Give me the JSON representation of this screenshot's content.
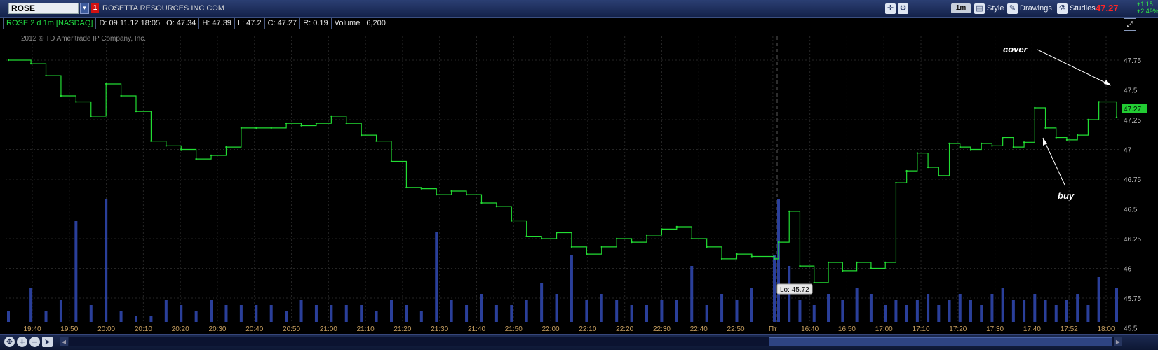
{
  "header": {
    "symbol": "ROSE",
    "link_badge": "1",
    "company": "ROSETTA RESOURCES INC COM",
    "aggregation": "1m",
    "style_label": "Style",
    "drawings_label": "Drawings",
    "studies_label": "Studies",
    "last_price": "47.27",
    "change_abs": "+1.15",
    "change_pct": "+2.49%",
    "icons": [
      "crosshair-icon",
      "wrench-icon",
      "style-icon",
      "drawings-icon",
      "studies-icon"
    ]
  },
  "info_bar": {
    "title": "ROSE 2 d 1m [NASDAQ]",
    "date": "D: 09.11.12 18:05",
    "open": "O: 47.34",
    "high": "H: 47.39",
    "low": "L: 47.2",
    "close": "C: 47.27",
    "range": "R: 0.19",
    "volume_label": "Volume",
    "volume_value": "6,200"
  },
  "chart_data": {
    "type": "line",
    "watermark": "2012 © TD Ameritrade IP Company, Inc.",
    "ylim": [
      45.55,
      47.95
    ],
    "y_ticks": [
      "47.75",
      "47.5",
      "47.25",
      "47",
      "46.75",
      "46.5",
      "46.25",
      "46",
      "45.75",
      "45.5"
    ],
    "price_tag": "47.27",
    "low_label": "Lo: 45.72",
    "x_tick_labels": [
      "19:40",
      "19:50",
      "20:00",
      "20:10",
      "20:20",
      "20:30",
      "20:40",
      "20:50",
      "21:00",
      "21:10",
      "21:20",
      "21:30",
      "21:40",
      "21:50",
      "22:00",
      "22:10",
      "22:20",
      "22:30",
      "22:40",
      "22:50",
      "Пт",
      "16:40",
      "16:50",
      "17:00",
      "17:10",
      "17:20",
      "17:30",
      "17:40",
      "17:52",
      "18:00"
    ],
    "series": [
      {
        "x": [
          "19:34",
          "19:40",
          "19:44",
          "19:48",
          "19:52",
          "19:56",
          "20:00",
          "20:04",
          "20:08",
          "20:12",
          "20:16",
          "20:20",
          "20:24",
          "20:28",
          "20:32",
          "20:36",
          "20:40",
          "20:44",
          "20:48",
          "20:52",
          "20:56",
          "21:00",
          "21:04",
          "21:08",
          "21:12",
          "21:16",
          "21:20",
          "21:24",
          "21:28",
          "21:32",
          "21:36",
          "21:40",
          "21:44",
          "21:48",
          "21:52",
          "21:56",
          "22:00",
          "22:04",
          "22:08",
          "22:12",
          "22:16",
          "22:20",
          "22:24",
          "22:28",
          "22:32",
          "22:36",
          "22:40",
          "22:44",
          "22:48",
          "22:52",
          "22:58",
          "16:30",
          "16:33",
          "16:36",
          "16:40",
          "16:44",
          "16:48",
          "16:52",
          "16:56",
          "17:00",
          "17:03",
          "17:06",
          "17:09",
          "17:12",
          "17:15",
          "17:18",
          "17:21",
          "17:24",
          "17:27",
          "17:30",
          "17:33",
          "17:36",
          "17:39",
          "17:42",
          "17:45",
          "17:48",
          "17:51",
          "17:54",
          "17:57",
          "18:00",
          "18:05"
        ],
        "values": [
          47.75,
          47.72,
          47.62,
          47.45,
          47.4,
          47.28,
          47.55,
          47.45,
          47.32,
          47.07,
          47.03,
          47.0,
          46.92,
          46.95,
          47.02,
          47.18,
          47.18,
          47.18,
          47.22,
          47.2,
          47.22,
          47.28,
          47.22,
          47.12,
          47.07,
          46.9,
          46.68,
          46.67,
          46.62,
          46.65,
          46.62,
          46.55,
          46.52,
          46.4,
          46.27,
          46.25,
          46.3,
          46.18,
          46.12,
          46.18,
          46.25,
          46.22,
          46.28,
          46.33,
          46.35,
          46.25,
          46.18,
          46.08,
          46.12,
          46.1,
          46.08,
          46.22,
          46.48,
          46.02,
          45.88,
          46.05,
          45.98,
          46.05,
          46.0,
          46.05,
          46.72,
          46.82,
          46.97,
          46.85,
          46.78,
          47.05,
          47.02,
          47.0,
          47.05,
          47.03,
          47.1,
          47.02,
          47.06,
          47.35,
          47.18,
          47.1,
          47.08,
          47.12,
          47.25,
          47.4,
          47.27
        ],
        "volume": [
          2,
          6,
          2,
          4,
          18,
          3,
          22,
          2,
          1,
          1,
          4,
          3,
          2,
          4,
          3,
          3,
          3,
          3,
          2,
          4,
          3,
          3,
          3,
          3,
          2,
          4,
          3,
          2,
          16,
          4,
          3,
          5,
          3,
          3,
          4,
          7,
          5,
          12,
          4,
          5,
          4,
          3,
          3,
          4,
          4,
          10,
          3,
          5,
          4,
          6,
          12,
          22,
          10,
          4,
          3,
          5,
          4,
          6,
          5,
          3,
          4,
          3,
          4,
          5,
          3,
          4,
          5,
          4,
          3,
          5,
          6,
          4,
          4,
          5,
          4,
          3,
          4,
          5,
          3,
          8,
          6
        ]
      }
    ]
  },
  "annotations": {
    "cover_label": "cover",
    "buy_label": "buy"
  }
}
